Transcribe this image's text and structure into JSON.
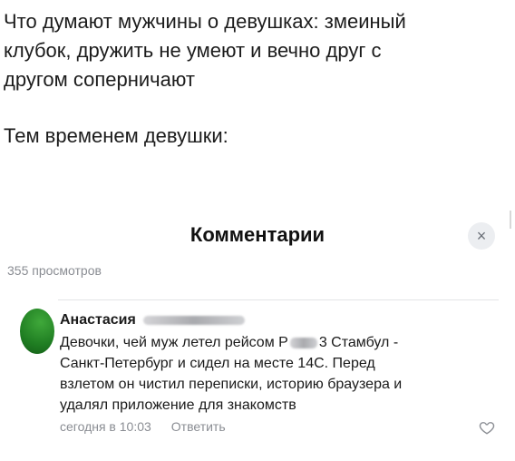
{
  "post": {
    "line1": "Что думают мужчины о девушках: змеиный",
    "line2": "клубок, дружить не умеют и вечно друг с",
    "line3": "другом соперничают",
    "line4": "Тем временем девушки:"
  },
  "comments_panel": {
    "title": "Комментарии",
    "close_symbol": "×",
    "views": "355 просмотров"
  },
  "comment": {
    "author": "Анастасия",
    "text_before_flight": "Девочки, чей муж летел рейсом Р",
    "text_after_flight": "3 Стамбул -",
    "line2": "Санкт-Петербург и сидел на месте 14С. Перед",
    "line3": "взлетом он чистил переписки, историю браузера и",
    "line4": "удалял приложение для знакомств",
    "time": "сегодня в 10:03",
    "reply_label": "Ответить",
    "like_icon": "heart-outline-icon"
  },
  "colors": {
    "avatar": "#2f8f2c",
    "muted_text": "#8a8d93",
    "close_bg": "#eceef1"
  }
}
